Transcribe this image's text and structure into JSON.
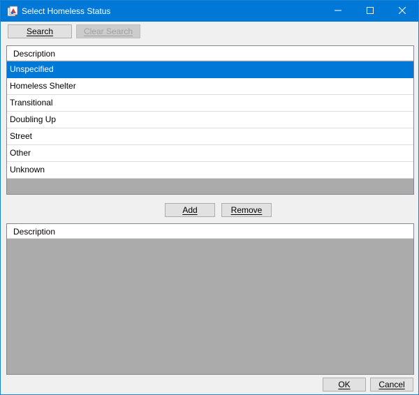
{
  "window": {
    "title": "Select Homeless Status",
    "minimize_icon": "minimize-icon",
    "maximize_icon": "maximize-icon",
    "close_icon": "close-icon"
  },
  "toolbar": {
    "search_label": "Search",
    "clear_search_label": "Clear Search"
  },
  "available_list": {
    "column_header": "Description",
    "items": [
      "Unspecified",
      "Homeless Shelter",
      "Transitional",
      "Doubling Up",
      "Street",
      "Other",
      "Unknown"
    ],
    "selected_item": "Unspecified"
  },
  "actions": {
    "add_label": "Add",
    "remove_label": "Remove"
  },
  "selected_list": {
    "column_header": "Description",
    "items": []
  },
  "footer": {
    "ok_label": "OK",
    "cancel_label": "Cancel"
  },
  "colors": {
    "title_bar": "#0078d7",
    "selection": "#0078d7",
    "grid_empty": "#ababab"
  }
}
